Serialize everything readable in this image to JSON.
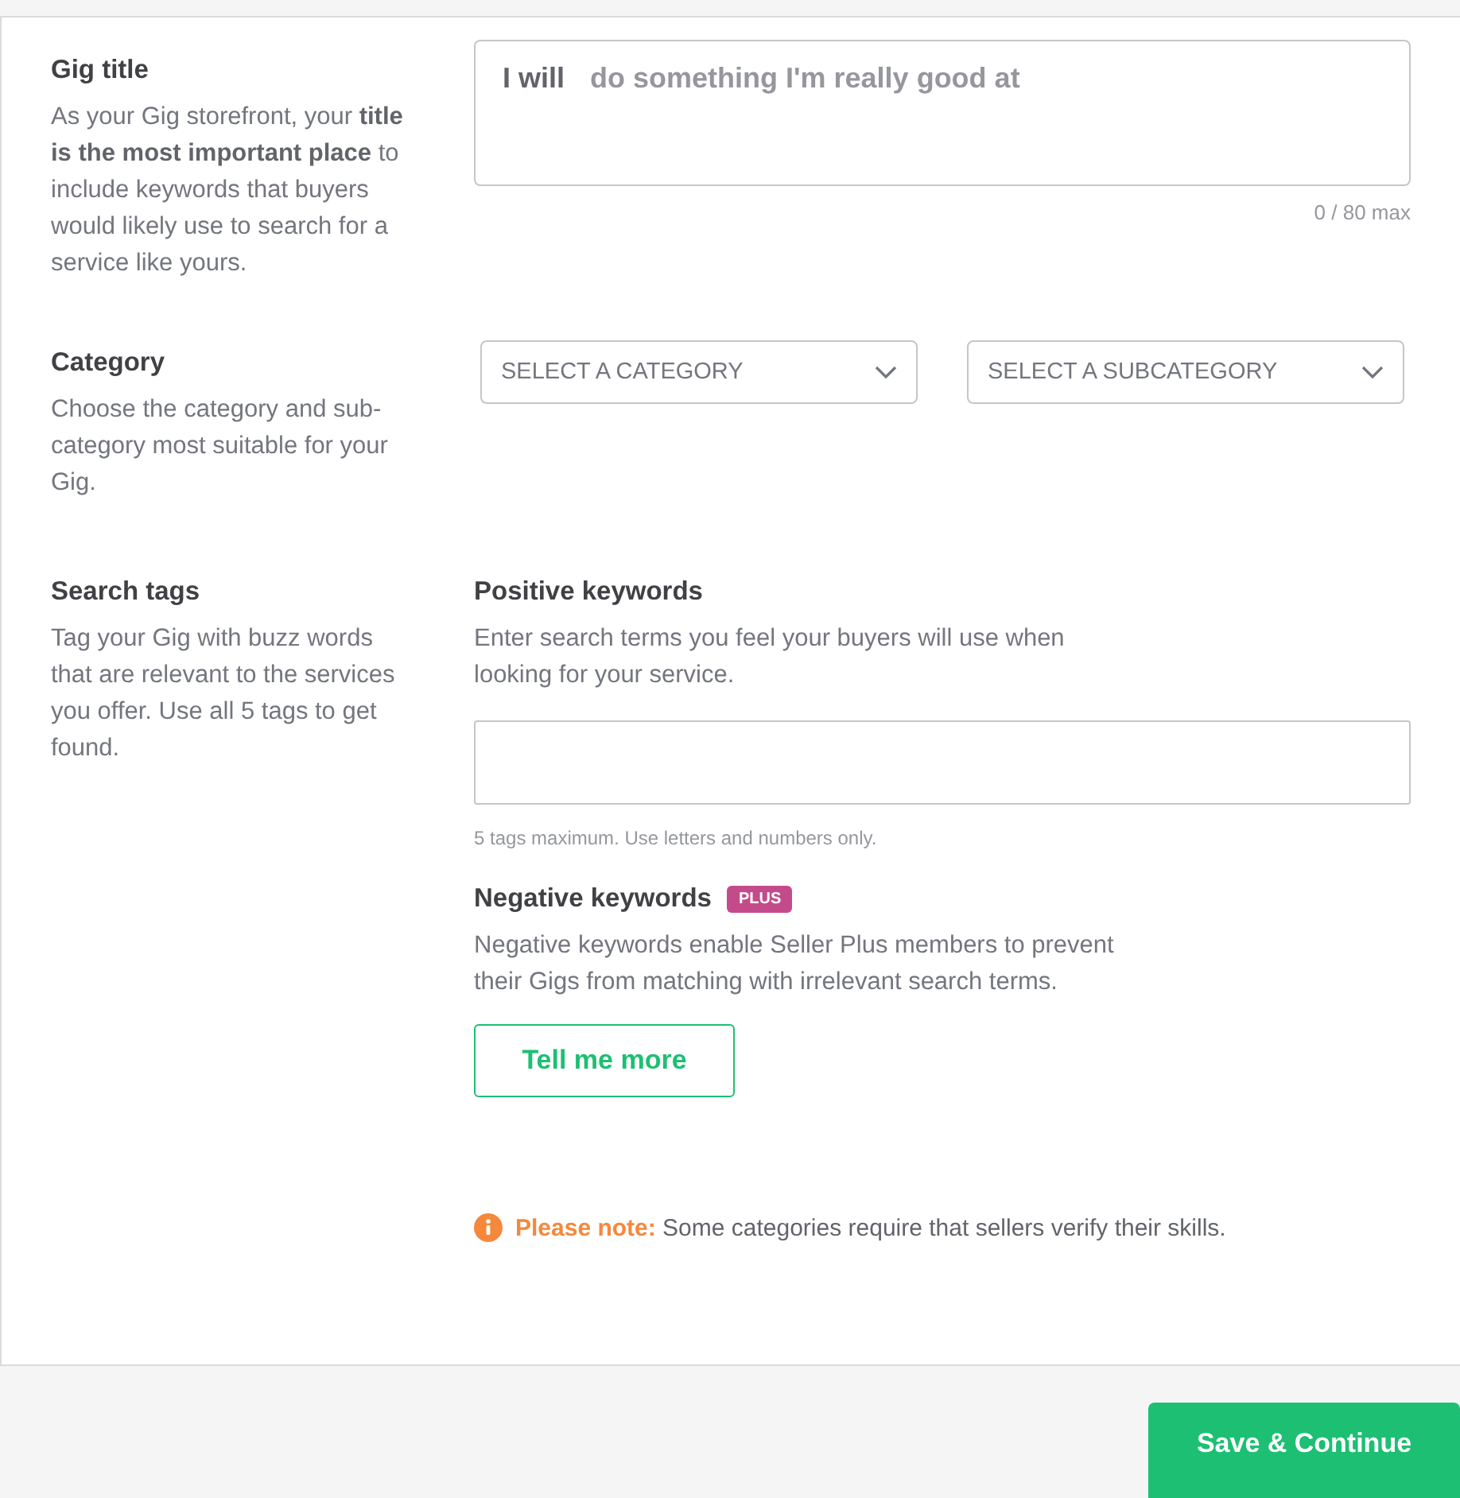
{
  "sections": [
    {
      "kind": "title",
      "heading": "Gig title",
      "description": "As your Gig storefront, your **title is the most important place** to include keywords that buyers would likely use to search for a service like yours.",
      "prefix": "I will",
      "placeholder": "do something I'm really good at",
      "counter": "0 / 80 max"
    },
    {
      "kind": "category",
      "heading": "Category",
      "description": "Choose the category and sub-category most suitable for your Gig.",
      "selects": [
        {
          "placeholder": "SELECT A CATEGORY"
        },
        {
          "placeholder": "SELECT A SUBCATEGORY"
        }
      ]
    },
    {
      "kind": "tags",
      "heading": "Search tags",
      "description": "Tag your Gig with buzz words that are relevant to the services you offer. Use all 5 tags to get found.",
      "positive": {
        "heading": "Positive keywords",
        "description": "Enter search terms you feel your buyers will use when looking for your service.",
        "hint": "5 tags maximum. Use letters and numbers only."
      },
      "negative": {
        "heading": "Negative keywords",
        "badge": "PLUS",
        "description": "Negative keywords enable Seller Plus members to prevent their Gigs from matching with irrelevant search terms.",
        "button": "Tell me more"
      }
    }
  ],
  "note": {
    "label": "Please note:",
    "text": "Some categories require that sellers verify their skills."
  },
  "footer": {
    "button": "Save & Continue"
  }
}
